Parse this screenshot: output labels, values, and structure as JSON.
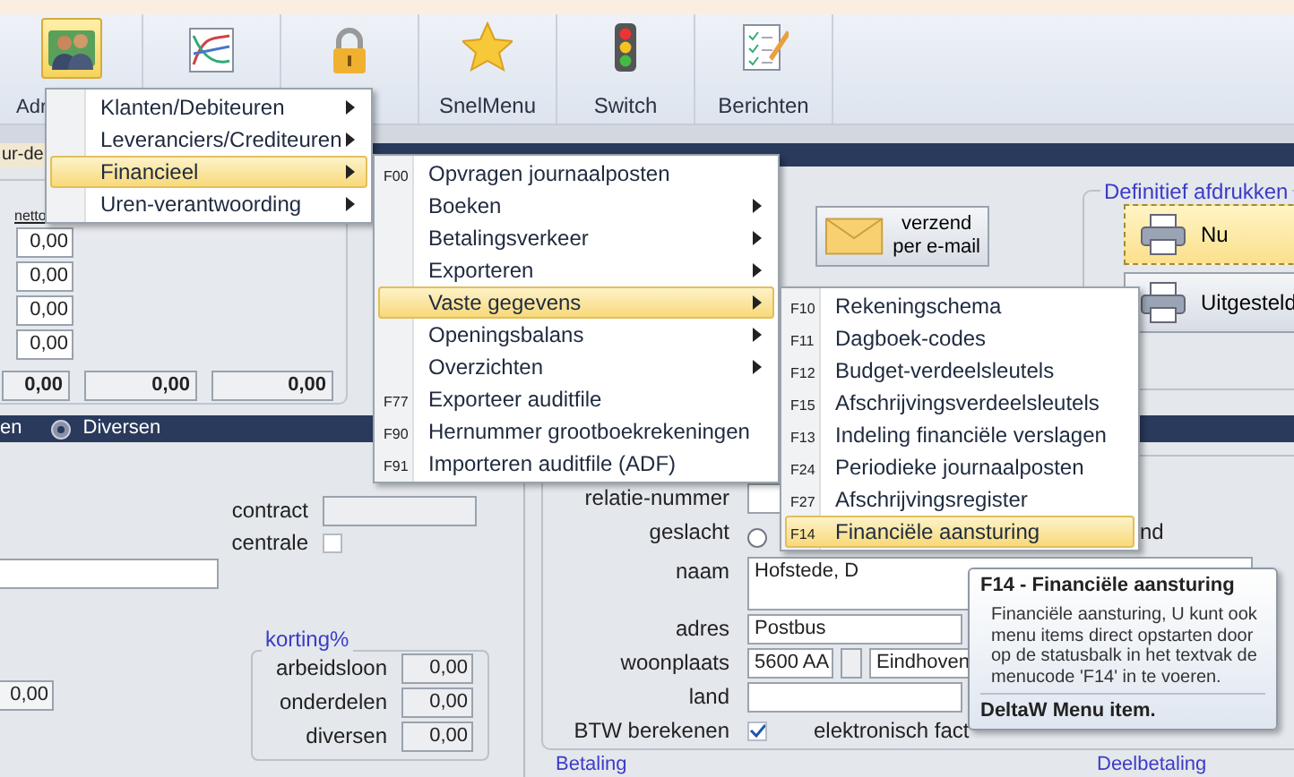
{
  "toolbar": {
    "buttons": [
      {
        "label": "Adr",
        "selected": true
      },
      {
        "selected": false
      },
      {
        "selected": false
      },
      {
        "label": "SnelMenu",
        "selected": false
      },
      {
        "label": "Switch",
        "selected": false
      },
      {
        "label": "Berichten",
        "selected": false
      }
    ]
  },
  "document_tab": {
    "label": "ur-de"
  },
  "totals_panel": {
    "column_header": "netto",
    "values": [
      "0,00",
      "0,00",
      "0,00",
      "0,00"
    ],
    "totals": [
      "0,00",
      "0,00",
      "0,00"
    ]
  },
  "section_bar": {
    "items": [
      {
        "label": "en",
        "icon": false
      },
      {
        "label": "Diversen",
        "icon": true
      }
    ]
  },
  "left_form": {
    "contract_label": "contract",
    "centrale_label": "centrale",
    "centrale_checked": false,
    "amount": "0,00"
  },
  "discount_group": {
    "title": "korting%",
    "rows": [
      {
        "label": "arbeidsloon",
        "value": "0,00"
      },
      {
        "label": "onderdelen",
        "value": "0,00"
      },
      {
        "label": "diversen",
        "value": "0,00"
      }
    ]
  },
  "email_button": {
    "lines": [
      "verzend",
      "per e-mail"
    ]
  },
  "print_group": {
    "title": "Definitief afdrukken",
    "buttons": [
      {
        "label": "Nu",
        "selected": true
      },
      {
        "label": "Uitgesteld",
        "selected": false
      }
    ]
  },
  "relation_form": {
    "rows": [
      {
        "kind": "field",
        "label": "relatie-nummer"
      },
      {
        "kind": "radio",
        "label": "geslacht",
        "checked": false,
        "trailing": "nd"
      },
      {
        "kind": "memo",
        "label": "naam",
        "value": "Hofstede, D"
      },
      {
        "kind": "field",
        "label": "adres",
        "value": "Postbus"
      },
      {
        "kind": "city",
        "label": "woonplaats",
        "postcode": "5600 AA",
        "value": "Eindhoven"
      },
      {
        "kind": "field",
        "label": "land"
      },
      {
        "kind": "check",
        "label": "BTW berekenen",
        "checked": true,
        "trailing": "elektronisch fact"
      }
    ]
  },
  "bottom_groups": [
    "Betaling",
    "Deelbetaling"
  ],
  "menus": [
    {
      "items": [
        {
          "label": "Klanten/Debiteuren",
          "submenu": true,
          "selected": false
        },
        {
          "label": "Leveranciers/Crediteuren",
          "submenu": true,
          "selected": false
        },
        {
          "label": "Financieel",
          "submenu": true,
          "selected": true
        },
        {
          "label": "Uren-verantwoording",
          "submenu": true,
          "selected": false
        }
      ]
    },
    {
      "items": [
        {
          "code": "F00",
          "label": "Opvragen journaalposten",
          "submenu": false,
          "selected": false
        },
        {
          "label": "Boeken",
          "submenu": true,
          "selected": false
        },
        {
          "label": "Betalingsverkeer",
          "submenu": true,
          "selected": false
        },
        {
          "label": "Exporteren",
          "submenu": true,
          "selected": false
        },
        {
          "label": "Vaste gegevens",
          "submenu": true,
          "selected": true
        },
        {
          "label": "Openingsbalans",
          "submenu": true,
          "selected": false
        },
        {
          "label": "Overzichten",
          "submenu": true,
          "selected": false
        },
        {
          "code": "F77",
          "label": "Exporteer auditfile",
          "submenu": false,
          "selected": false
        },
        {
          "code": "F90",
          "label": "Hernummer grootboekrekeningen",
          "submenu": false,
          "selected": false
        },
        {
          "code": "F91",
          "label": "Importeren auditfile (ADF)",
          "submenu": false,
          "selected": false
        }
      ]
    },
    {
      "items": [
        {
          "code": "F10",
          "label": "Rekeningschema",
          "submenu": false,
          "selected": false
        },
        {
          "code": "F11",
          "label": "Dagboek-codes",
          "submenu": false,
          "selected": false
        },
        {
          "code": "F12",
          "label": "Budget-verdeelsleutels",
          "submenu": false,
          "selected": false
        },
        {
          "code": "F15",
          "label": "Afschrijvingsverdeelsleutels",
          "submenu": false,
          "selected": false
        },
        {
          "code": "F13",
          "label": "Indeling financiële verslagen",
          "submenu": false,
          "selected": false
        },
        {
          "code": "F24",
          "label": "Periodieke journaalposten",
          "submenu": false,
          "selected": false
        },
        {
          "code": "F27",
          "label": "Afschrijvingsregister",
          "submenu": false,
          "selected": false
        },
        {
          "code": "F14",
          "label": "Financiële aansturing",
          "submenu": false,
          "selected": true
        }
      ]
    }
  ],
  "tooltip": {
    "title": "F14 - Financiële aansturing",
    "body": "Financiële aansturing, U kunt ook menu items direct opstarten door op de statusbalk in het textvak de menucode 'F14' in te voeren.",
    "footer": "DeltaW Menu item."
  }
}
